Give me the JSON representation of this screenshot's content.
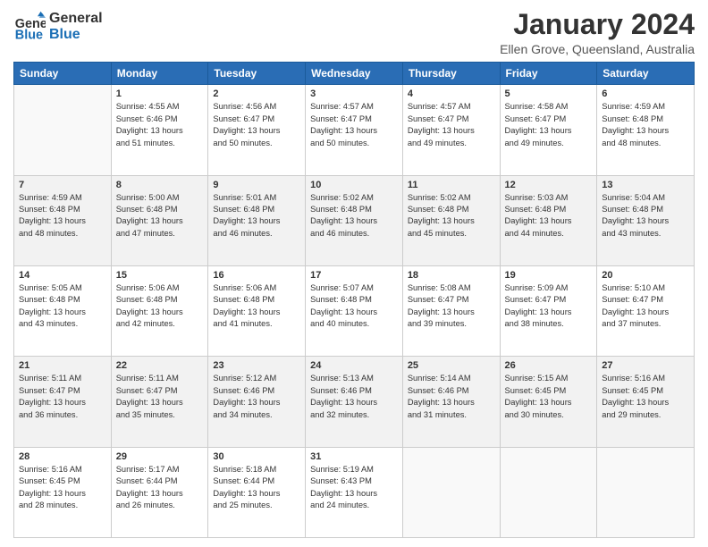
{
  "header": {
    "logo_line1": "General",
    "logo_line2": "Blue",
    "title": "January 2024",
    "subtitle": "Ellen Grove, Queensland, Australia"
  },
  "days_of_week": [
    "Sunday",
    "Monday",
    "Tuesday",
    "Wednesday",
    "Thursday",
    "Friday",
    "Saturday"
  ],
  "weeks": [
    [
      {
        "day": "",
        "info": ""
      },
      {
        "day": "1",
        "info": "Sunrise: 4:55 AM\nSunset: 6:46 PM\nDaylight: 13 hours\nand 51 minutes."
      },
      {
        "day": "2",
        "info": "Sunrise: 4:56 AM\nSunset: 6:47 PM\nDaylight: 13 hours\nand 50 minutes."
      },
      {
        "day": "3",
        "info": "Sunrise: 4:57 AM\nSunset: 6:47 PM\nDaylight: 13 hours\nand 50 minutes."
      },
      {
        "day": "4",
        "info": "Sunrise: 4:57 AM\nSunset: 6:47 PM\nDaylight: 13 hours\nand 49 minutes."
      },
      {
        "day": "5",
        "info": "Sunrise: 4:58 AM\nSunset: 6:47 PM\nDaylight: 13 hours\nand 49 minutes."
      },
      {
        "day": "6",
        "info": "Sunrise: 4:59 AM\nSunset: 6:48 PM\nDaylight: 13 hours\nand 48 minutes."
      }
    ],
    [
      {
        "day": "7",
        "info": "Sunrise: 4:59 AM\nSunset: 6:48 PM\nDaylight: 13 hours\nand 48 minutes."
      },
      {
        "day": "8",
        "info": "Sunrise: 5:00 AM\nSunset: 6:48 PM\nDaylight: 13 hours\nand 47 minutes."
      },
      {
        "day": "9",
        "info": "Sunrise: 5:01 AM\nSunset: 6:48 PM\nDaylight: 13 hours\nand 46 minutes."
      },
      {
        "day": "10",
        "info": "Sunrise: 5:02 AM\nSunset: 6:48 PM\nDaylight: 13 hours\nand 46 minutes."
      },
      {
        "day": "11",
        "info": "Sunrise: 5:02 AM\nSunset: 6:48 PM\nDaylight: 13 hours\nand 45 minutes."
      },
      {
        "day": "12",
        "info": "Sunrise: 5:03 AM\nSunset: 6:48 PM\nDaylight: 13 hours\nand 44 minutes."
      },
      {
        "day": "13",
        "info": "Sunrise: 5:04 AM\nSunset: 6:48 PM\nDaylight: 13 hours\nand 43 minutes."
      }
    ],
    [
      {
        "day": "14",
        "info": "Sunrise: 5:05 AM\nSunset: 6:48 PM\nDaylight: 13 hours\nand 43 minutes."
      },
      {
        "day": "15",
        "info": "Sunrise: 5:06 AM\nSunset: 6:48 PM\nDaylight: 13 hours\nand 42 minutes."
      },
      {
        "day": "16",
        "info": "Sunrise: 5:06 AM\nSunset: 6:48 PM\nDaylight: 13 hours\nand 41 minutes."
      },
      {
        "day": "17",
        "info": "Sunrise: 5:07 AM\nSunset: 6:48 PM\nDaylight: 13 hours\nand 40 minutes."
      },
      {
        "day": "18",
        "info": "Sunrise: 5:08 AM\nSunset: 6:47 PM\nDaylight: 13 hours\nand 39 minutes."
      },
      {
        "day": "19",
        "info": "Sunrise: 5:09 AM\nSunset: 6:47 PM\nDaylight: 13 hours\nand 38 minutes."
      },
      {
        "day": "20",
        "info": "Sunrise: 5:10 AM\nSunset: 6:47 PM\nDaylight: 13 hours\nand 37 minutes."
      }
    ],
    [
      {
        "day": "21",
        "info": "Sunrise: 5:11 AM\nSunset: 6:47 PM\nDaylight: 13 hours\nand 36 minutes."
      },
      {
        "day": "22",
        "info": "Sunrise: 5:11 AM\nSunset: 6:47 PM\nDaylight: 13 hours\nand 35 minutes."
      },
      {
        "day": "23",
        "info": "Sunrise: 5:12 AM\nSunset: 6:46 PM\nDaylight: 13 hours\nand 34 minutes."
      },
      {
        "day": "24",
        "info": "Sunrise: 5:13 AM\nSunset: 6:46 PM\nDaylight: 13 hours\nand 32 minutes."
      },
      {
        "day": "25",
        "info": "Sunrise: 5:14 AM\nSunset: 6:46 PM\nDaylight: 13 hours\nand 31 minutes."
      },
      {
        "day": "26",
        "info": "Sunrise: 5:15 AM\nSunset: 6:45 PM\nDaylight: 13 hours\nand 30 minutes."
      },
      {
        "day": "27",
        "info": "Sunrise: 5:16 AM\nSunset: 6:45 PM\nDaylight: 13 hours\nand 29 minutes."
      }
    ],
    [
      {
        "day": "28",
        "info": "Sunrise: 5:16 AM\nSunset: 6:45 PM\nDaylight: 13 hours\nand 28 minutes."
      },
      {
        "day": "29",
        "info": "Sunrise: 5:17 AM\nSunset: 6:44 PM\nDaylight: 13 hours\nand 26 minutes."
      },
      {
        "day": "30",
        "info": "Sunrise: 5:18 AM\nSunset: 6:44 PM\nDaylight: 13 hours\nand 25 minutes."
      },
      {
        "day": "31",
        "info": "Sunrise: 5:19 AM\nSunset: 6:43 PM\nDaylight: 13 hours\nand 24 minutes."
      },
      {
        "day": "",
        "info": ""
      },
      {
        "day": "",
        "info": ""
      },
      {
        "day": "",
        "info": ""
      }
    ]
  ]
}
